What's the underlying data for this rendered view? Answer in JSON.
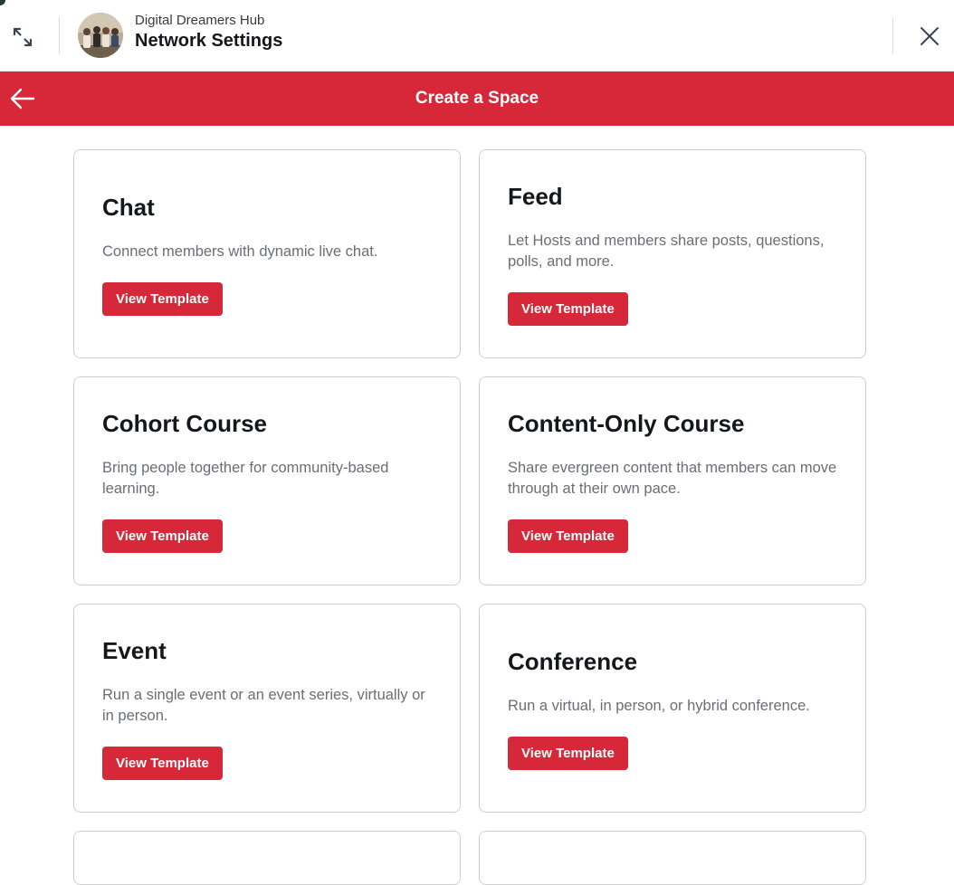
{
  "header": {
    "org_name": "Digital Dreamers Hub",
    "title": "Network Settings",
    "expand_icon": "expand-arrows-icon",
    "close_icon": "close-icon",
    "avatar": "community-group-photo"
  },
  "subheader": {
    "title": "Create a Space",
    "back_icon": "arrow-left-icon",
    "background_color": "#d62839"
  },
  "colors": {
    "accent": "#d62839",
    "title_text": "#15171c",
    "body_text": "#6b6e76",
    "card_border": "#cfcfcf"
  },
  "templates": [
    {
      "title": "Chat",
      "description": "Connect members with dynamic live chat.",
      "button_label": "View Template"
    },
    {
      "title": "Feed",
      "description": "Let Hosts and members share posts, questions, polls, and more.",
      "button_label": "View Template"
    },
    {
      "title": "Cohort Course",
      "description": "Bring people together for community-based learning.",
      "button_label": "View Template"
    },
    {
      "title": "Content-Only Course",
      "description": "Share evergreen content that members can move through at their own pace.",
      "button_label": "View Template"
    },
    {
      "title": "Event",
      "description": "Run a single event or an event series, virtually or in person.",
      "button_label": "View Template"
    },
    {
      "title": "Conference",
      "description": "Run a virtual, in person, or hybrid conference.",
      "button_label": "View Template"
    }
  ]
}
